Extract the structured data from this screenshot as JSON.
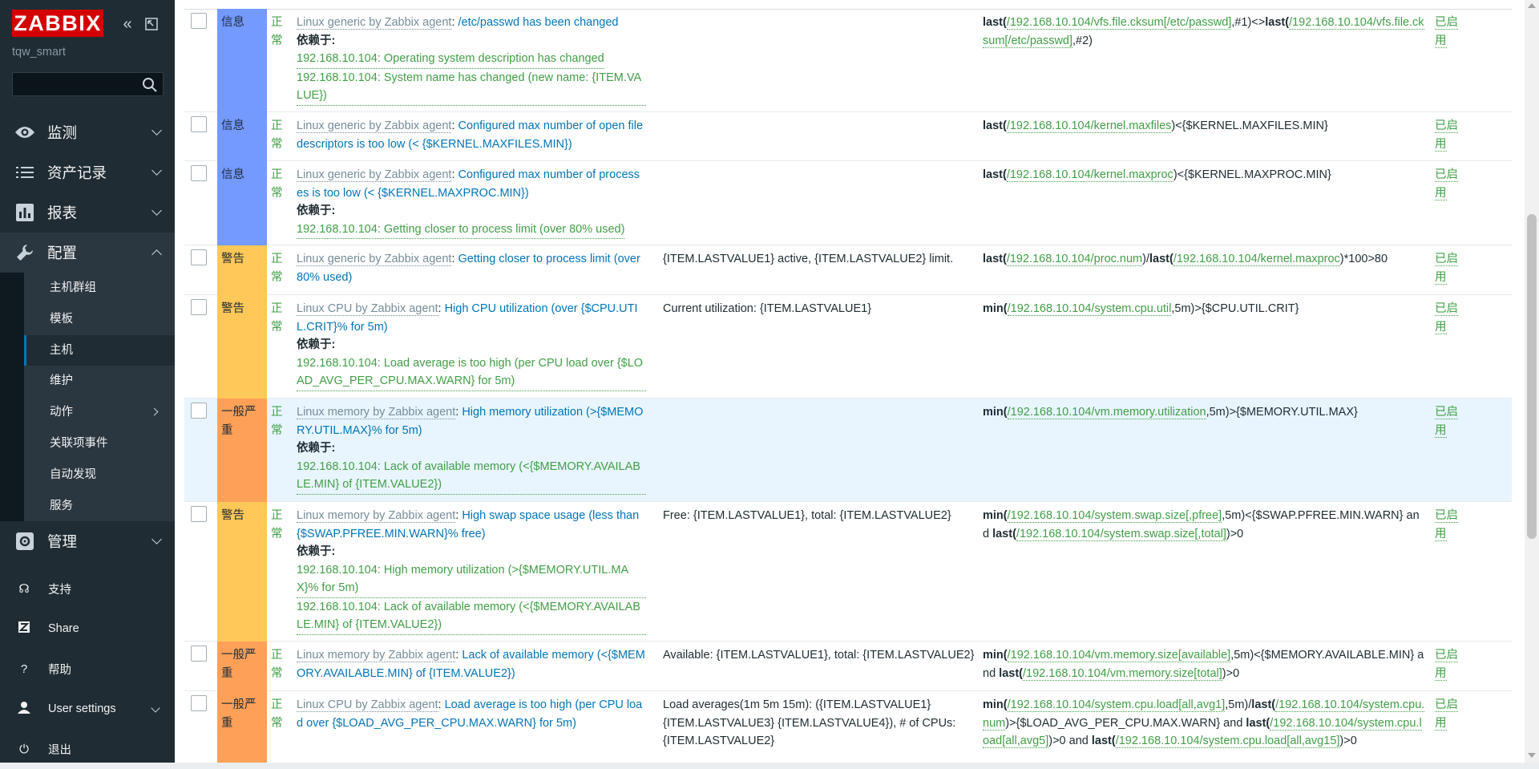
{
  "sidebar": {
    "logo": "ZABBIX",
    "server_name": "tqw_smart",
    "search": {
      "value": "",
      "placeholder": ""
    },
    "menu": [
      {
        "label": "监测",
        "icon": "eye-icon"
      },
      {
        "label": "资产记录",
        "icon": "list-icon"
      },
      {
        "label": "报表",
        "icon": "bar-chart-icon"
      },
      {
        "label": "配置",
        "icon": "wrench-icon"
      }
    ],
    "config_submenu": [
      "主机群组",
      "模板",
      "主机",
      "维护",
      "动作",
      "关联项事件",
      "自动发现",
      "服务"
    ],
    "admin": {
      "label": "管理",
      "icon": "gear-icon"
    },
    "bottom": [
      {
        "label": "支持",
        "icon": "headset-icon"
      },
      {
        "label": "Share",
        "icon": "share-icon"
      },
      {
        "label": "帮助",
        "icon": "help-icon"
      },
      {
        "label": "User settings",
        "icon": "user-icon"
      },
      {
        "label": "退出",
        "icon": "power-icon"
      }
    ]
  },
  "labels": {
    "depends_on": "依赖于:",
    "enabled": "已启用",
    "status_ok": "正常"
  },
  "colors": {
    "info": "#7499ff",
    "warning": "#ffc859",
    "average": "#ffa059",
    "ok": "#429e47",
    "link": "#0275b8",
    "template": "#768d99"
  },
  "triggers": [
    {
      "severity": "信息",
      "severity_level": "info",
      "template": "Linux generic by Zabbix agent",
      "name": "/etc/passwd has been changed",
      "dependencies": [
        "192.168.10.104: Operating system description has changed",
        "192.168.10.104: System name has changed (new name: {ITEM.VALUE})"
      ],
      "opdata": "",
      "expression": [
        [
          "b",
          "last("
        ],
        [
          "l",
          "/192.168.10.104/vfs.file.cksum[/etc/passwd]"
        ],
        [
          "t",
          ",#1)<>"
        ],
        [
          "b",
          "last("
        ],
        [
          "l",
          "/192.168.10.104/vfs.file.cksum[/etc/passwd]"
        ],
        [
          "t",
          ",#2)"
        ]
      ]
    },
    {
      "severity": "信息",
      "severity_level": "info",
      "template": "Linux generic by Zabbix agent",
      "name": "Configured max number of open filedescriptors is too low (< {$KERNEL.MAXFILES.MIN})",
      "dependencies": [],
      "opdata": "",
      "expression": [
        [
          "b",
          "last("
        ],
        [
          "l",
          "/192.168.10.104/kernel.maxfiles"
        ],
        [
          "t",
          ")<{$KERNEL.MAXFILES.MIN}"
        ]
      ]
    },
    {
      "severity": "信息",
      "severity_level": "info",
      "template": "Linux generic by Zabbix agent",
      "name": "Configured max number of processes is too low (< {$KERNEL.MAXPROC.MIN})",
      "dependencies": [
        "192.168.10.104: Getting closer to process limit (over 80% used)"
      ],
      "opdata": "",
      "expression": [
        [
          "b",
          "last("
        ],
        [
          "l",
          "/192.168.10.104/kernel.maxproc"
        ],
        [
          "t",
          ")<{$KERNEL.MAXPROC.MIN}"
        ]
      ]
    },
    {
      "severity": "警告",
      "severity_level": "warning",
      "template": "Linux generic by Zabbix agent",
      "name": "Getting closer to process limit (over 80% used)",
      "dependencies": [],
      "opdata": "{ITEM.LASTVALUE1} active, {ITEM.LASTVALUE2} limit.",
      "expression": [
        [
          "b",
          "last("
        ],
        [
          "l",
          "/192.168.10.104/proc.num"
        ],
        [
          "t",
          ")/"
        ],
        [
          "b",
          "last("
        ],
        [
          "l",
          "/192.168.10.104/kernel.maxproc"
        ],
        [
          "t",
          ")*100>80"
        ]
      ]
    },
    {
      "severity": "警告",
      "severity_level": "warning",
      "template": "Linux CPU by Zabbix agent",
      "name": "High CPU utilization (over {$CPU.UTIL.CRIT}% for 5m)",
      "dependencies": [
        "192.168.10.104: Load average is too high (per CPU load over {$LOAD_AVG_PER_CPU.MAX.WARN} for 5m)"
      ],
      "opdata": "Current utilization: {ITEM.LASTVALUE1}",
      "expression": [
        [
          "b",
          "min("
        ],
        [
          "l",
          "/192.168.10.104/system.cpu.util"
        ],
        [
          "t",
          ",5m)>{$CPU.UTIL.CRIT}"
        ]
      ]
    },
    {
      "severity": "一般严重",
      "severity_level": "average",
      "template": "Linux memory by Zabbix agent",
      "name": "High memory utilization (>{$MEMORY.UTIL.MAX}% for 5m)",
      "dependencies": [
        "192.168.10.104: Lack of available memory (<{$MEMORY.AVAILABLE.MIN} of {ITEM.VALUE2})"
      ],
      "opdata": "",
      "expression": [
        [
          "b",
          "min("
        ],
        [
          "l",
          "/192.168.10.104/vm.memory.utilization"
        ],
        [
          "t",
          ",5m)>{$MEMORY.UTIL.MAX}"
        ]
      ],
      "highlight": true
    },
    {
      "severity": "警告",
      "severity_level": "warning",
      "template": "Linux memory by Zabbix agent",
      "name": "High swap space usage (less than {$SWAP.PFREE.MIN.WARN}% free)",
      "dependencies": [
        "192.168.10.104: High memory utilization (>{$MEMORY.UTIL.MAX}% for 5m)",
        "192.168.10.104: Lack of available memory (<{$MEMORY.AVAILABLE.MIN} of {ITEM.VALUE2})"
      ],
      "opdata": "Free: {ITEM.LASTVALUE1}, total: {ITEM.LASTVALUE2}",
      "expression": [
        [
          "b",
          "min("
        ],
        [
          "l",
          "/192.168.10.104/system.swap.size[,pfree]"
        ],
        [
          "t",
          ",5m)<{$SWAP.PFREE.MIN.WARN} and "
        ],
        [
          "b",
          "last("
        ],
        [
          "l",
          "/192.168.10.104/system.swap.size[,total]"
        ],
        [
          "t",
          ")>0"
        ]
      ]
    },
    {
      "severity": "一般严重",
      "severity_level": "average",
      "template": "Linux memory by Zabbix agent",
      "name": "Lack of available memory (<{$MEMORY.AVAILABLE.MIN} of {ITEM.VALUE2})",
      "dependencies": [],
      "opdata": "Available: {ITEM.LASTVALUE1}, total: {ITEM.LASTVALUE2}",
      "expression": [
        [
          "b",
          "min("
        ],
        [
          "l",
          "/192.168.10.104/vm.memory.size[available]"
        ],
        [
          "t",
          ",5m)<{$MEMORY.AVAILABLE.MIN} and "
        ],
        [
          "b",
          "last("
        ],
        [
          "l",
          "/192.168.10.104/vm.memory.size[total]"
        ],
        [
          "t",
          ")>0"
        ]
      ]
    },
    {
      "severity": "一般严重",
      "severity_level": "average",
      "template": "Linux CPU by Zabbix agent",
      "name": "Load average is too high (per CPU load over {$LOAD_AVG_PER_CPU.MAX.WARN} for 5m)",
      "dependencies": [],
      "opdata": "Load averages(1m 5m 15m): ({ITEM.LASTVALUE1} {ITEM.LASTVALUE3} {ITEM.LASTVALUE4}), # of CPUs: {ITEM.LASTVALUE2}",
      "expression": [
        [
          "b",
          "min("
        ],
        [
          "l",
          "/192.168.10.104/system.cpu.load[all,avg1]"
        ],
        [
          "t",
          ",5m)/"
        ],
        [
          "b",
          "last("
        ],
        [
          "l",
          "/192.168.10.104/system.cpu.num"
        ],
        [
          "t",
          ")>{$LOAD_AVG_PER_CPU.MAX.WARN} and "
        ],
        [
          "b",
          "last("
        ],
        [
          "l",
          "/192.168.10.104/system.cpu.load[all,avg5]"
        ],
        [
          "t",
          ")>0 and "
        ],
        [
          "b",
          "last("
        ],
        [
          "l",
          "/192.168.10.104/system.cpu.load[all,avg15]"
        ],
        [
          "t",
          ")>0"
        ]
      ]
    }
  ]
}
